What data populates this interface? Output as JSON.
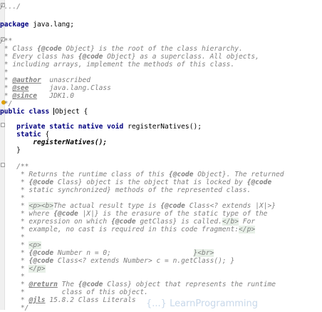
{
  "lines": {
    "l0": "/.../",
    "l1": "package java.lang;",
    "l2": "/**",
    "l3a": " * Class ",
    "l3b": "{@code",
    "l3c": " Object}",
    "l3d": " is the root of the class hierarchy.",
    "l4a": " * Every class has ",
    "l4b": "{@code",
    "l4c": " Object}",
    "l4d": " as a superclass. All objects,",
    "l5": " * including arrays, implement the methods of this class.",
    "l6": " *",
    "l7a": " * ",
    "l7b": "@author",
    "l7c": "  unascribed",
    "l8a": " * ",
    "l8b": "@see",
    "l8c": "     java.lang.Class",
    "l9a": " * ",
    "l9b": "@since",
    "l9c": "   JDK1.0",
    "l10": " */",
    "l11a": "public class ",
    "l11b": "Object",
    "l11c": " {",
    "l12a": "    private static native void ",
    "l12b": "registerNatives();",
    "l13a": "    static",
    "l13b": " {",
    "l14": "        registerNatives();",
    "l15": "    }",
    "l16": "    /**",
    "l17a": "     * Returns the runtime class of this ",
    "l17b": "{@code",
    "l17c": " Object}. The returned",
    "l18a": "     * ",
    "l18b": "{@code",
    "l18c": " Class}",
    "l18d": " object is the object that is locked by ",
    "l18e": "{@code",
    "l19": "     * static synchronized} methods of the represented class.",
    "l20": "     *",
    "l21a": "     * ",
    "l21b": "<p><b>",
    "l21c": "The actual result type is ",
    "l21d": "{@code",
    "l21e": " Class<? extends |X|>}",
    "l22a": "     * where ",
    "l22b": "{@code",
    "l22c": " |X|}",
    "l22d": " is the erasure of the static type of the",
    "l23a": "     * expression on which ",
    "l23b": "{@code",
    "l23c": " getClass}",
    "l23d": " is called.",
    "l23e": "</b>",
    "l23f": " For",
    "l24a": "     * example, no cast is required in this code fragment:",
    "l24b": "</p>",
    "l25": "     *",
    "l26a": "     * ",
    "l26b": "<p>",
    "l27a": "     * ",
    "l27b": "{@code",
    "l27c": " Number n = 0;",
    "l27d": "                    ",
    "l27e": "}<br>",
    "l28a": "     * ",
    "l28b": "{@code",
    "l28c": " Class<? extends Number> c = n.getClass(); }",
    "l29a": "     * ",
    "l29b": "</p>",
    "l30": "     *",
    "l31a": "     * ",
    "l31b": "@return",
    "l31c": " The ",
    "l31d": "{@code",
    "l31e": " Class}",
    "l31f": " object that represents the runtime",
    "l32": "     *         class of this object.",
    "l33a": "     * ",
    "l33b": "@jls",
    "l33c": " 15.8.2 Class Literals",
    "l34": "     */"
  },
  "colors": {
    "keyword": "#000080",
    "comment": "#808080",
    "background": "#ffffff",
    "gutter": "#f0f0f0"
  },
  "icons": {
    "bulb": "lightbulb-icon"
  },
  "watermark": "{...}  LearnProgramming"
}
